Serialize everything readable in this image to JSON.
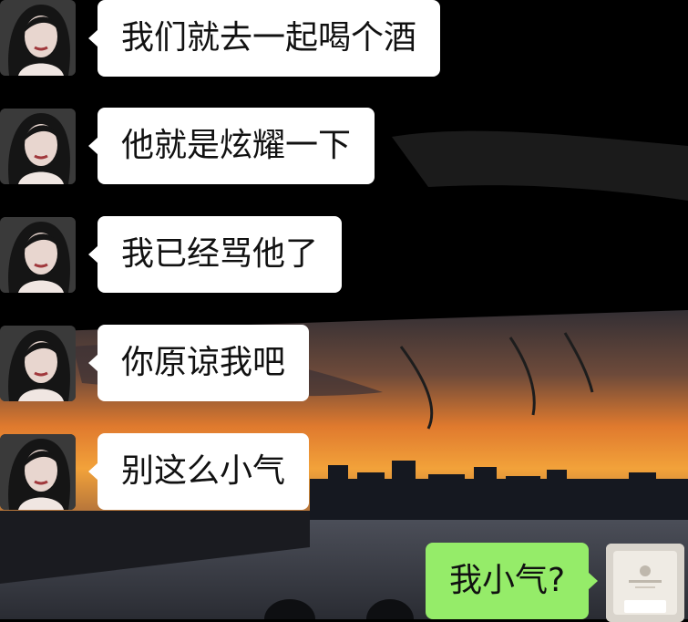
{
  "colors": {
    "incoming_bubble": "#ffffff",
    "outgoing_bubble": "#95ec69",
    "text": "#111111"
  },
  "messages": [
    {
      "from": "contact",
      "text": "我们就去一起喝个酒"
    },
    {
      "from": "contact",
      "text": "他就是炫耀一下"
    },
    {
      "from": "contact",
      "text": "我已经骂他了"
    },
    {
      "from": "contact",
      "text": "你原谅我吧"
    },
    {
      "from": "contact",
      "text": "别这么小气"
    },
    {
      "from": "me",
      "text": "我小气?"
    }
  ],
  "icons": {
    "contact_avatar": "woman-portrait-avatar",
    "my_avatar": "product-box-avatar"
  }
}
